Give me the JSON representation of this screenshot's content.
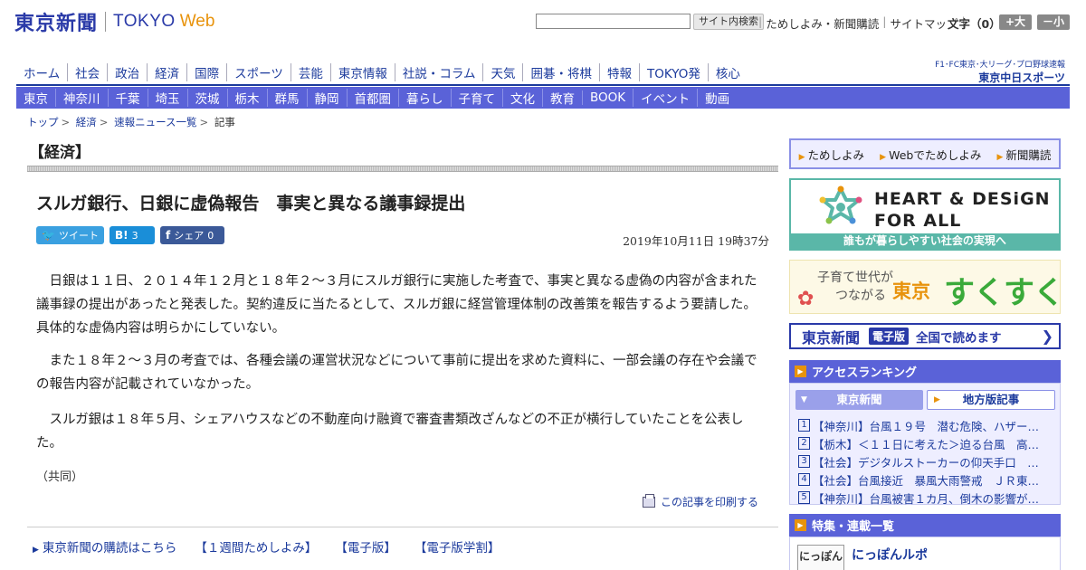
{
  "header": {
    "logo_jp": "東京新聞",
    "logo_en": "TOKYO",
    "logo_web": "Web",
    "search_button": "サイト内検索",
    "util_links": [
      "ためしよみ・新聞購読",
      "サイトマップ"
    ],
    "font_size_label": "文字（0）",
    "font_bigger": "+大",
    "font_smaller": "－小"
  },
  "nav_primary": [
    "ホーム",
    "社会",
    "政治",
    "経済",
    "国際",
    "スポーツ",
    "芸能",
    "東京情報",
    "社説・コラム",
    "天気",
    "囲碁・将棋",
    "特報",
    "TOKYO発",
    "核心"
  ],
  "chunichi": {
    "line1": "F1･FC東京･大リーグ･プロ野球速報",
    "line2": "東京中日スポーツ"
  },
  "nav_secondary": [
    "東京",
    "神奈川",
    "千葉",
    "埼玉",
    "茨城",
    "栃木",
    "群馬",
    "静岡",
    "首都圏",
    "暮らし",
    "子育て",
    "文化",
    "教育",
    "BOOK",
    "イベント",
    "動画"
  ],
  "breadcrumb": [
    "トップ",
    "経済",
    "速報ニュース一覧",
    "記事"
  ],
  "section_title": "【経済】",
  "article": {
    "title": "スルガ銀行、日銀に虚偽報告　事実と異なる議事録提出",
    "timestamp": "2019年10月11日 19時37分",
    "paragraphs": [
      "日銀は１１日、２０１４年１２月と１８年２～３月にスルガ銀行に実施した考査で、事実と異なる虚偽の内容が含まれた議事録の提出があったと発表した。契約違反に当たるとして、スルガ銀に経営管理体制の改善策を報告するよう要請した。具体的な虚偽内容は明らかにしていない。",
      "また１８年２～３月の考査では、各種会議の運営状況などについて事前に提出を求めた資料に、一部会議の存在や会議での報告内容が記載されていなかった。",
      "スルガ銀は１８年５月、シェアハウスなどの不動産向け融資で審査書類改ざんなどの不正が横行していたことを公表した。"
    ],
    "credit": "（共同）",
    "print_link": "この記事を印刷する"
  },
  "social": {
    "tweet": "ツイート",
    "hatena_icon": "B!",
    "hatena_count": "3",
    "fb_icon": "f",
    "share": "シェア",
    "share_count": "0"
  },
  "footer_links": [
    "東京新聞の購読はこちら",
    "【１週間ためしよみ】",
    "【電子版】",
    "【電子版学割】"
  ],
  "sidebar": {
    "trial_links": [
      "ためしよみ",
      "Webでためしよみ",
      "新聞購読"
    ],
    "heart_line1": "HEART & DESiGN",
    "heart_line2": "FOR ALL",
    "heart_caption": "誰もが暮らしやすい社会の実現へ",
    "suku_line1": "子育て世代が",
    "suku_line2": "つながる",
    "suku_big1": "東京",
    "suku_big2": "すくすく",
    "denshi_logo": "東京新聞",
    "denshi_badge": "電子版",
    "denshi_text": "全国で読めます",
    "ranking_title": "アクセスランキング",
    "ranking_tabs": [
      "東京新聞",
      "地方版記事"
    ],
    "ranking": [
      {
        "num": "1",
        "text": "【神奈川】台風１９号　潜む危険、ハザー…"
      },
      {
        "num": "2",
        "text": "【栃木】＜１１日に考えた＞迫る台風　高…"
      },
      {
        "num": "3",
        "text": "【社会】デジタルストーカーの仰天手口　…"
      },
      {
        "num": "4",
        "text": "【社会】台風接近　暴風大雨警戒　ＪＲ東…"
      },
      {
        "num": "5",
        "text": "【神奈川】台風被害１カ月、倒木の影響が…"
      }
    ],
    "feature_title": "特集・連載一覧",
    "feature_thumb": "にっぽん",
    "feature_item": "にっぽんルポ"
  },
  "colors": {
    "brand_blue": "#2a3aa8",
    "nav_purple": "#5a62d8",
    "accent_orange": "#e8930c"
  }
}
